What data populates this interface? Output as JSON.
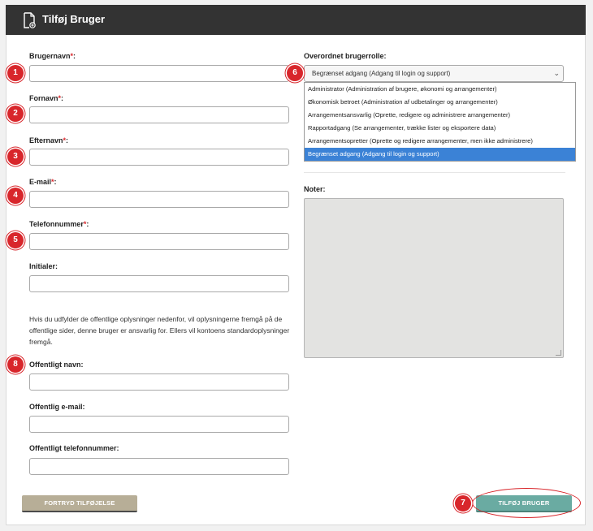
{
  "header": {
    "title": "Tilføj Bruger",
    "icon": "add-document-icon"
  },
  "form": {
    "required_mark": "*",
    "username_label": "Brugernavn",
    "username_value": "",
    "firstname_label": "Fornavn",
    "firstname_value": "",
    "lastname_label": "Efternavn",
    "lastname_value": "",
    "email_label": "E-mail",
    "email_value": "",
    "phone_label": "Telefonnummer",
    "phone_value": "",
    "initials_label": "Initialer",
    "initials_value": "",
    "info_text": "Hvis du udfylder de offentlige oplysninger nedenfor, vil oplysningerne fremgå på de offentlige sider, denne bruger er ansvarlig for. Ellers vil kontoens standardoplysninger fremgå.",
    "public_name_label": "Offentligt navn:",
    "public_name_value": "",
    "public_email_label": "Offentlig e-mail:",
    "public_email_value": "",
    "public_phone_label": "Offentligt telefonnummer:",
    "public_phone_value": ""
  },
  "role": {
    "label": "Overordnet brugerrolle:",
    "selected": "Begrænset adgang (Adgang til login og support)",
    "options": [
      "Administrator (Administration af brugere, økonomi og arrangementer)",
      "Økonomisk betroet (Administration af udbetalinger og arrangementer)",
      "Arrangementsansvarlig (Oprette, redigere og administrere arrangementer)",
      "Rapportadgang (Se arrangementer, trække lister og eksportere data)",
      "Arrangementsopretter (Oprette og redigere arrangementer, men ikke administrere)",
      "Begrænset adgang (Adgang til login og support)"
    ]
  },
  "notes": {
    "label": "Noter:",
    "value": ""
  },
  "buttons": {
    "cancel": "FORTRYD TILFØJELSE",
    "submit": "TILFØJ BRUGER"
  },
  "badges": [
    "1",
    "2",
    "3",
    "4",
    "5",
    "6",
    "7",
    "8"
  ],
  "colors": {
    "header": "#333333",
    "badge": "#d8262b",
    "required": "#d9262b",
    "submit": "#6aaba2",
    "cancel": "#b7ae97",
    "selected_option": "#3b82d6"
  }
}
